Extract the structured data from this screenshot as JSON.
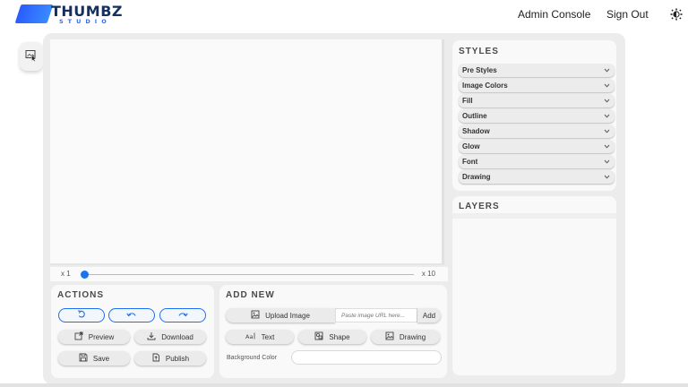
{
  "header": {
    "logo_text": "THUMBZ",
    "logo_sub": "STUDIO",
    "admin_console": "Admin Console",
    "sign_out": "Sign Out",
    "theme_icon": "brightness-icon"
  },
  "canvas": {
    "zoom_min": "x 1",
    "zoom_max": "x 10",
    "zoom_value": 0.0
  },
  "actions": {
    "title": "ACTIONS",
    "reset_icon": "reset-icon",
    "undo_icon": "undo-icon",
    "redo_icon": "redo-icon",
    "preview": "Preview",
    "download": "Download",
    "save": "Save",
    "publish": "Publish"
  },
  "add_new": {
    "title": "ADD NEW",
    "upload_image": "Upload Image",
    "url_placeholder": "Paste image URL here...",
    "add": "Add",
    "text": "Text",
    "shape": "Shape",
    "drawing": "Drawing",
    "background_color": "Background Color"
  },
  "styles": {
    "title": "STYLES",
    "items": [
      {
        "label": "Pre Styles"
      },
      {
        "label": "Image Colors"
      },
      {
        "label": "Fill"
      },
      {
        "label": "Outline"
      },
      {
        "label": "Shadow"
      },
      {
        "label": "Glow"
      },
      {
        "label": "Font"
      },
      {
        "label": "Drawing"
      }
    ]
  },
  "layers": {
    "title": "LAYERS"
  },
  "colors": {
    "accent": "#1d6ff2",
    "logo_blue": "#2a5cff",
    "panel_bg": "#f9f9f9",
    "frame_bg": "#ececec"
  }
}
